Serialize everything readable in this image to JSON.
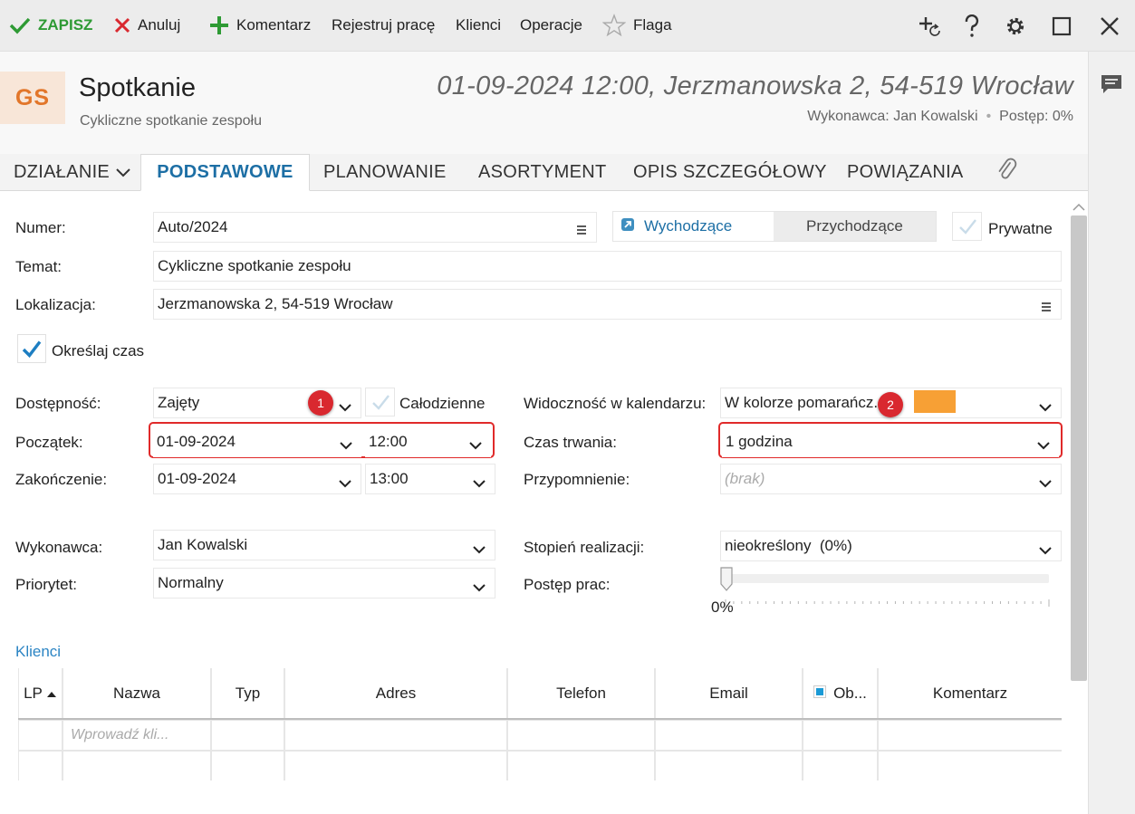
{
  "toolbar": {
    "save": "ZAPISZ",
    "cancel": "Anuluj",
    "comment": "Komentarz",
    "register_work": "Rejestruj pracę",
    "clients": "Klienci",
    "operations": "Operacje",
    "flag": "Flaga"
  },
  "header": {
    "initials": "GS",
    "title": "Spotkanie",
    "subtitle": "Cykliczne spotkanie zespołu",
    "datetime_location": "01-09-2024 12:00, Jerzmanowska 2, 54-519 Wrocław",
    "performer_info": "Wykonawca: Jan Kowalski",
    "separator": "•",
    "progress_info": "Postęp: 0%"
  },
  "tabs": {
    "action": "DZIAŁANIE",
    "basic": "PODSTAWOWE",
    "planning": "PLANOWANIE",
    "assortment": "ASORTYMENT",
    "detailed_desc": "OPIS SZCZEGÓŁOWY",
    "relations": "POWIĄZANIA"
  },
  "form": {
    "number_label": "Numer:",
    "number_value": "Auto/2024",
    "direction_outgoing": "Wychodzące",
    "direction_incoming": "Przychodzące",
    "private_label": "Prywatne",
    "subject_label": "Temat:",
    "subject_value": "Cykliczne spotkanie zespołu",
    "location_label": "Lokalizacja:",
    "location_value": "Jerzmanowska 2, 54-519 Wrocław",
    "specify_time_label": "Określaj czas",
    "availability_label": "Dostępność:",
    "availability_value": "Zajęty",
    "all_day_label": "Całodzienne",
    "calendar_visibility_label": "Widoczność w kalendarzu:",
    "calendar_visibility_value": "W kolorze pomarańcz...",
    "calendar_color": "#f7a035",
    "start_label": "Początek:",
    "start_date": "01-09-2024",
    "start_time": "12:00",
    "duration_label": "Czas trwania:",
    "duration_value": "1 godzina",
    "end_label": "Zakończenie:",
    "end_date": "01-09-2024",
    "end_time": "13:00",
    "reminder_label": "Przypomnienie:",
    "reminder_value": "(brak)",
    "performer_label": "Wykonawca:",
    "performer_value": "Jan Kowalski",
    "completion_label": "Stopień realizacji:",
    "completion_value": "nieokreślony  (0%)",
    "priority_label": "Priorytet:",
    "priority_value": "Normalny",
    "work_progress_label": "Postęp prac:",
    "work_progress_value": "0%",
    "work_progress_fraction": 0
  },
  "annotations": {
    "badge1": "1",
    "badge2": "2"
  },
  "clients": {
    "section_title": "Klienci",
    "columns": [
      "LP",
      "Nazwa",
      "Typ",
      "Adres",
      "Telefon",
      "Email",
      "Ob...",
      "Komentarz"
    ],
    "input_placeholder": "Wprowadź kli..."
  },
  "colors": {
    "accent": "#1d6fa5",
    "save_green": "#2e9a34",
    "cancel_red": "#d9282f",
    "highlight_red": "#e02a2a",
    "initials_orange": "#e2762a"
  }
}
